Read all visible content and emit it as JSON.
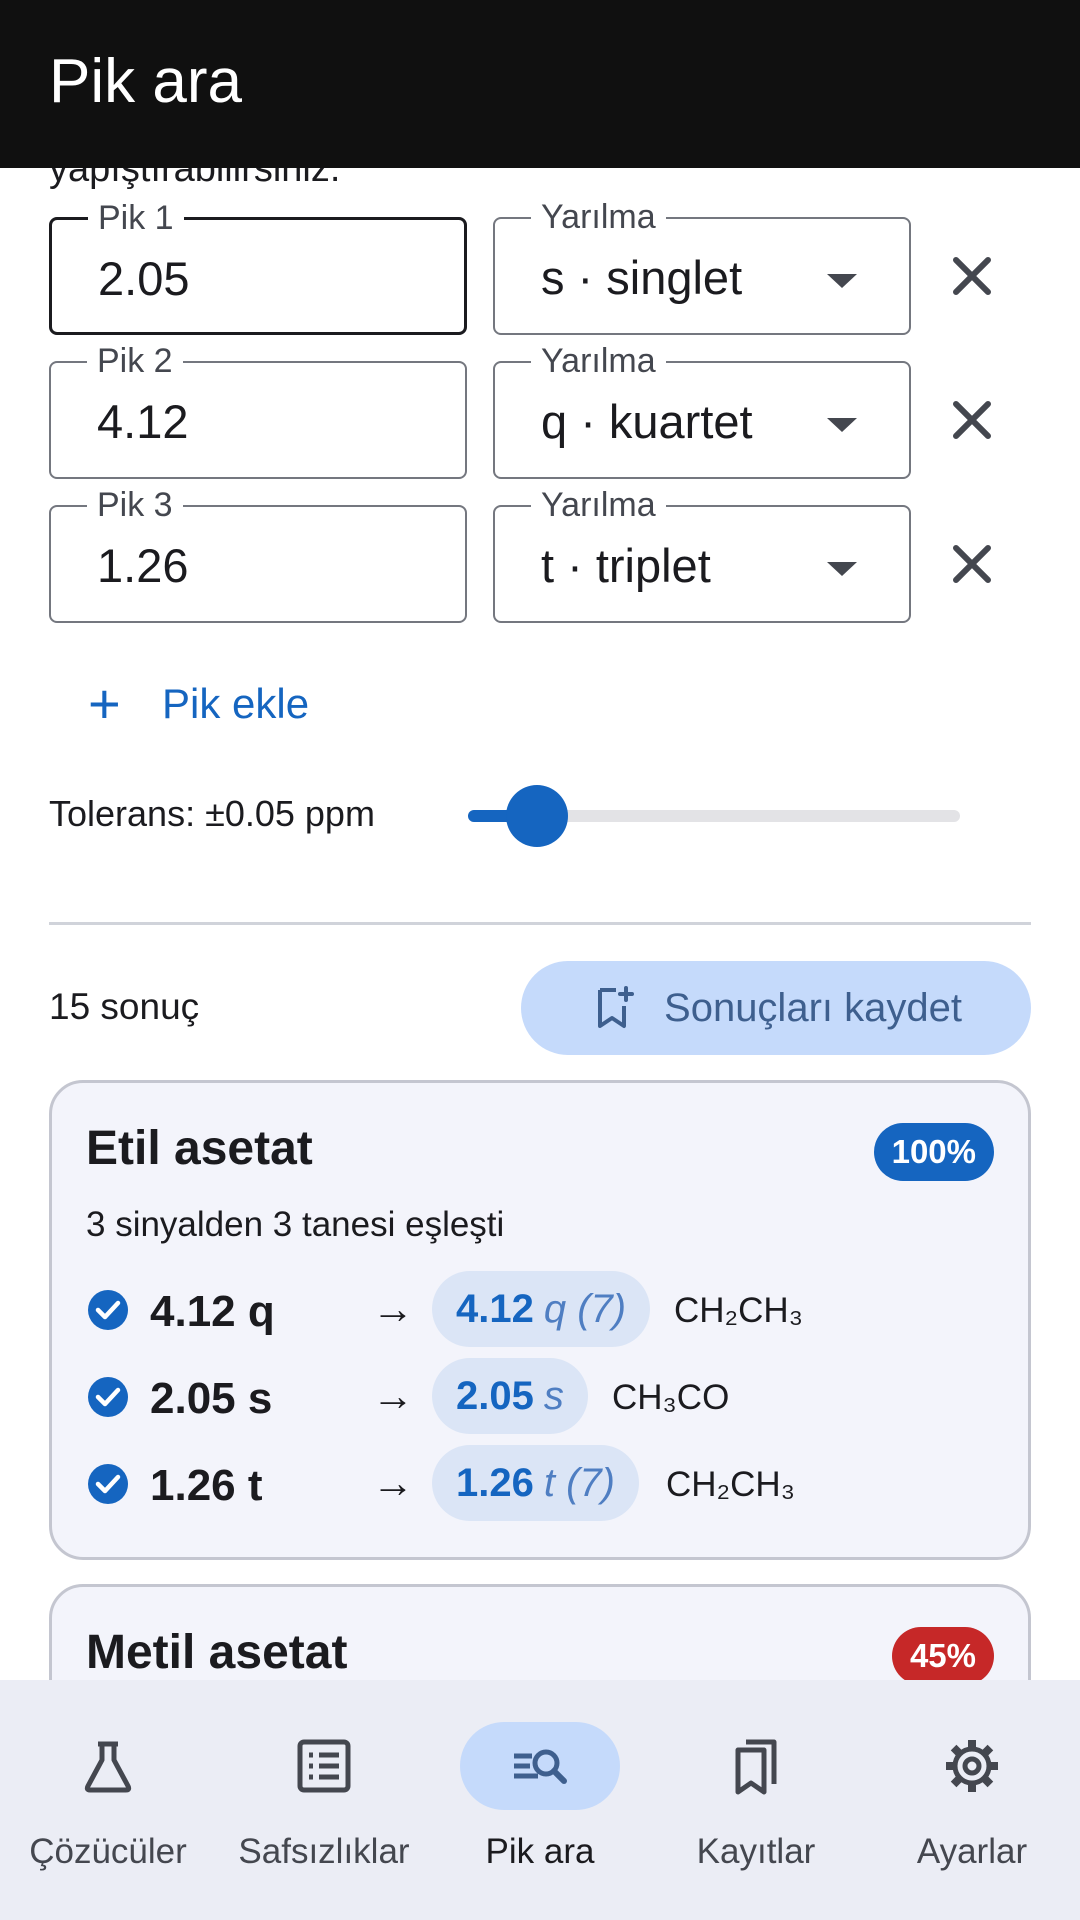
{
  "app_bar": {
    "title": "Pik ara"
  },
  "intro_text_clipped": "yapıştırabilirsiniz.",
  "peaks": [
    {
      "label": "Pik 1",
      "value": "2.05",
      "splitting_label": "Yarılma",
      "splitting": "s · singlet"
    },
    {
      "label": "Pik 2",
      "value": "4.12",
      "splitting_label": "Yarılma",
      "splitting": "q · kuartet"
    },
    {
      "label": "Pik 3",
      "value": "1.26",
      "splitting_label": "Yarılma",
      "splitting": "t · triplet"
    }
  ],
  "add_peak": {
    "label": "Pik ekle"
  },
  "tolerance": {
    "label": "Tolerans: ±0.05 ppm",
    "slider_fraction": 0.14
  },
  "results": {
    "count_label": "15 sonuç",
    "save_label": "Sonuçları kaydet",
    "cards": [
      {
        "name": "Etil asetat",
        "match_percent": "100%",
        "badge_color": "#1565c0",
        "subtitle": "3 sinyalden 3 tanesi eşleşti",
        "matches": [
          {
            "peak": "4.12 q",
            "arrow": "→",
            "ref_value": "4.12",
            "ref_mult": "q (7)",
            "group": "CH₂CH₃"
          },
          {
            "peak": "2.05 s",
            "arrow": "→",
            "ref_value": "2.05",
            "ref_mult": "s",
            "group": "CH₃CO"
          },
          {
            "peak": "1.26 t",
            "arrow": "→",
            "ref_value": "1.26",
            "ref_mult": "t (7)",
            "group": "CH₂CH₃"
          }
        ]
      },
      {
        "name": "Metil asetat",
        "match_percent": "45%",
        "badge_color": "#c62828"
      }
    ]
  },
  "bottom_nav": {
    "items": [
      {
        "label": "Çözücüler",
        "icon": "flask-icon"
      },
      {
        "label": "Safsızlıklar",
        "icon": "list-icon"
      },
      {
        "label": "Pik ara",
        "icon": "peak-search-icon",
        "active": true
      },
      {
        "label": "Kayıtlar",
        "icon": "bookmarks-icon"
      },
      {
        "label": "Ayarlar",
        "icon": "gear-icon"
      }
    ]
  },
  "colors": {
    "primary": "#1565c0",
    "app_bar": "#101010",
    "nav_active_pill": "#c5dafb",
    "danger": "#c62828"
  }
}
